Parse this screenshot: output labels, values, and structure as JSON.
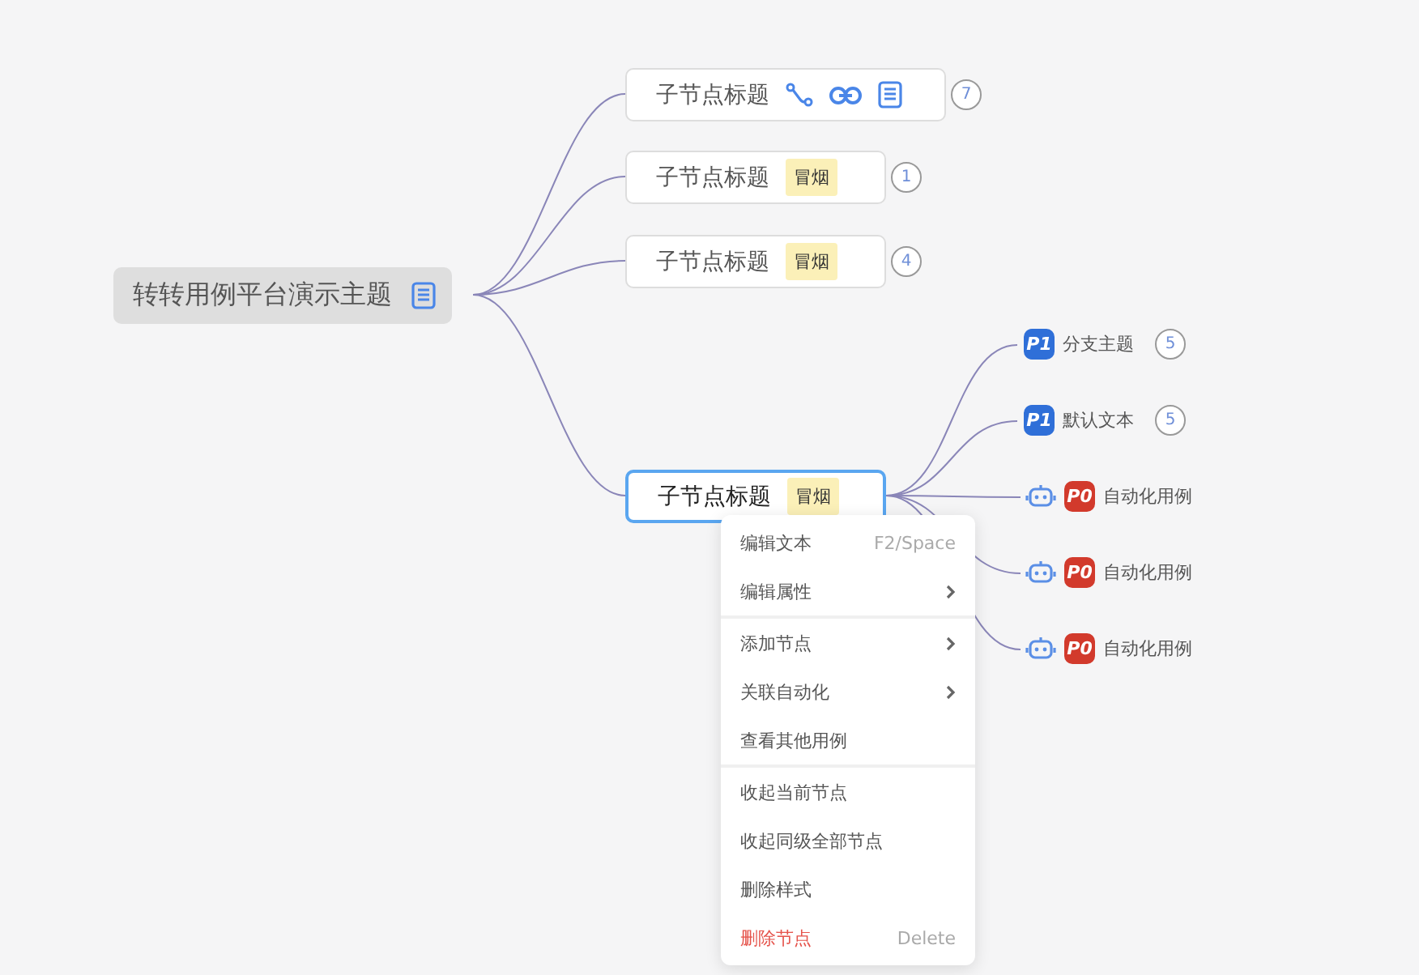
{
  "root": {
    "title": "转转用例平台演示主题",
    "note": true
  },
  "children": [
    {
      "title": "子节点标题",
      "icons": [
        {
          "kind": "branch"
        },
        {
          "kind": "link"
        },
        {
          "kind": "note"
        }
      ],
      "count": "7",
      "selected": false
    },
    {
      "title": "子节点标题",
      "tag": "冒烟",
      "count": "1",
      "selected": false
    },
    {
      "title": "子节点标题",
      "tag": "冒烟",
      "count": "4",
      "selected": false
    },
    {
      "title": "子节点标题",
      "tag": "冒烟",
      "selected": true,
      "children": [
        {
          "kind": "priority",
          "priority": "P1",
          "color": "#2f6fd8",
          "text": "分支主题",
          "count": "5"
        },
        {
          "kind": "priority",
          "priority": "P1",
          "color": "#2f6fd8",
          "text": "默认文本",
          "count": "5"
        },
        {
          "kind": "automation",
          "priority": "P0",
          "color": "#d23a2c",
          "text": "自动化用例"
        },
        {
          "kind": "automation",
          "priority": "P0",
          "color": "#d23a2c",
          "text": "自动化用例"
        },
        {
          "kind": "automation",
          "priority": "P0",
          "color": "#d23a2c",
          "text": "自动化用例"
        }
      ]
    }
  ],
  "context_menu": {
    "groups": [
      [
        {
          "label": "编辑文本",
          "shortcut": "F2/Space",
          "submenu": false,
          "danger": false
        },
        {
          "label": "编辑属性",
          "submenu": true,
          "danger": false
        }
      ],
      [
        {
          "label": "添加节点",
          "submenu": true,
          "danger": false
        },
        {
          "label": "关联自动化",
          "submenu": true,
          "danger": false
        },
        {
          "label": "查看其他用例",
          "submenu": false,
          "danger": false
        }
      ],
      [
        {
          "label": "收起当前节点",
          "submenu": false,
          "danger": false
        },
        {
          "label": "收起同级全部节点",
          "submenu": false,
          "danger": false
        },
        {
          "label": "删除样式",
          "submenu": false,
          "danger": false
        },
        {
          "label": "删除节点",
          "shortcut": "Delete",
          "submenu": false,
          "danger": true
        }
      ]
    ]
  }
}
